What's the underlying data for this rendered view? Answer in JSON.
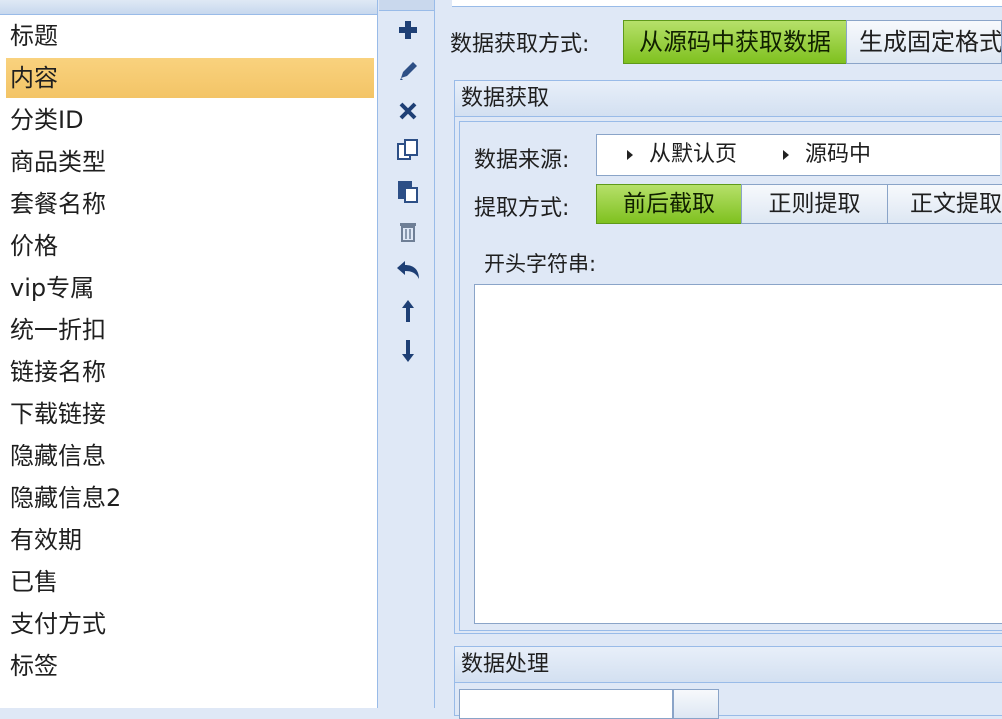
{
  "fields": [
    {
      "label": "标题"
    },
    {
      "label": "内容",
      "selected": true
    },
    {
      "label": "分类ID"
    },
    {
      "label": "商品类型"
    },
    {
      "label": "套餐名称"
    },
    {
      "label": "价格"
    },
    {
      "label": "vip专属"
    },
    {
      "label": "统一折扣"
    },
    {
      "label": "链接名称"
    },
    {
      "label": "下载链接"
    },
    {
      "label": "隐藏信息"
    },
    {
      "label": "隐藏信息2"
    },
    {
      "label": "有效期"
    },
    {
      "label": "已售"
    },
    {
      "label": "支付方式"
    },
    {
      "label": "标签"
    }
  ],
  "toolbar": {
    "icons": [
      "plus-icon",
      "pencil-icon",
      "x-icon",
      "copy-icon",
      "paste-icon",
      "trash-icon",
      "undo-icon",
      "arrow-up-icon",
      "arrow-down-icon"
    ]
  },
  "acquire": {
    "label": "数据获取方式:",
    "options": [
      "从源码中获取数据",
      "生成固定格式"
    ],
    "active": 0
  },
  "fetch_panel": {
    "title": "数据获取",
    "source_label": "数据来源:",
    "source_path": [
      "从默认页",
      "源码中"
    ],
    "method_label": "提取方式:",
    "methods": [
      "前后截取",
      "正则提取",
      "正文提取"
    ],
    "active_method": 0,
    "start_label": "开头字符串:",
    "start_value": ""
  },
  "process_panel": {
    "title": "数据处理"
  },
  "colors": {
    "active_green": "#8fcb2e",
    "selection": "#f6c96f",
    "border": "#99bbe8",
    "panel_bg": "#dfe8f6"
  }
}
